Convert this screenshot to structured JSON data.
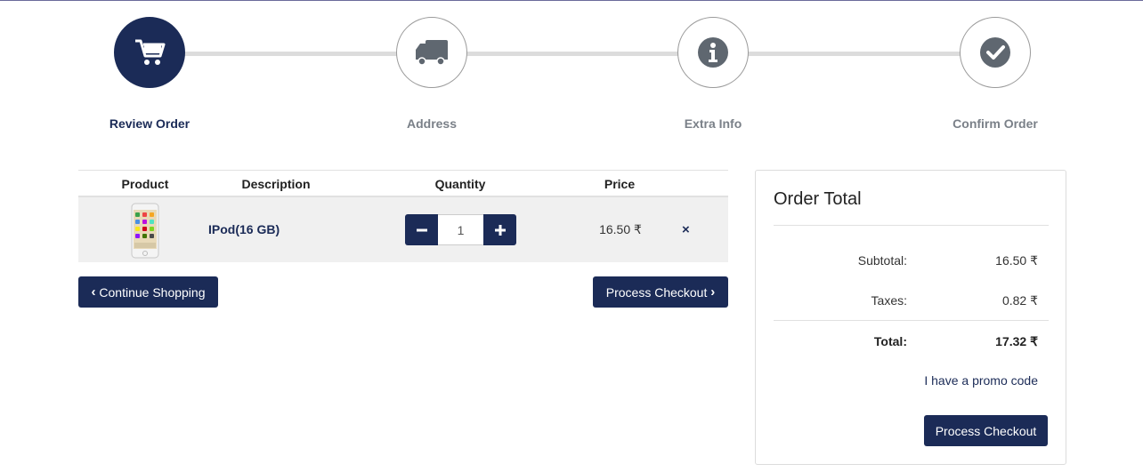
{
  "wizard": {
    "steps": [
      {
        "label": "Review Order",
        "icon": "cart-icon",
        "active": true
      },
      {
        "label": "Address",
        "icon": "truck-icon",
        "active": false
      },
      {
        "label": "Extra Info",
        "icon": "info-icon",
        "active": false
      },
      {
        "label": "Confirm Order",
        "icon": "check-circle-icon",
        "active": false
      }
    ]
  },
  "cart": {
    "headers": {
      "product": "Product",
      "description": "Description",
      "quantity": "Quantity",
      "price": "Price"
    },
    "items": [
      {
        "description": "IPod(16 GB)",
        "quantity": "1",
        "price": "16.50 ₹",
        "remove": "×",
        "image": "ipod-image"
      }
    ],
    "continue_label": "Continue Shopping",
    "checkout_label": "Process Checkout"
  },
  "order_total": {
    "title": "Order Total",
    "subtotal_label": "Subtotal:",
    "subtotal_value": "16.50 ₹",
    "taxes_label": "Taxes:",
    "taxes_value": "0.82 ₹",
    "total_label": "Total:",
    "total_value": "17.32 ₹",
    "promo_label": "I have a promo code",
    "checkout_label": "Process Checkout"
  },
  "colors": {
    "primary": "#1b2b57",
    "muted": "#7a8088",
    "track": "#dcdcdc",
    "row_bg": "#f0f0f0"
  }
}
